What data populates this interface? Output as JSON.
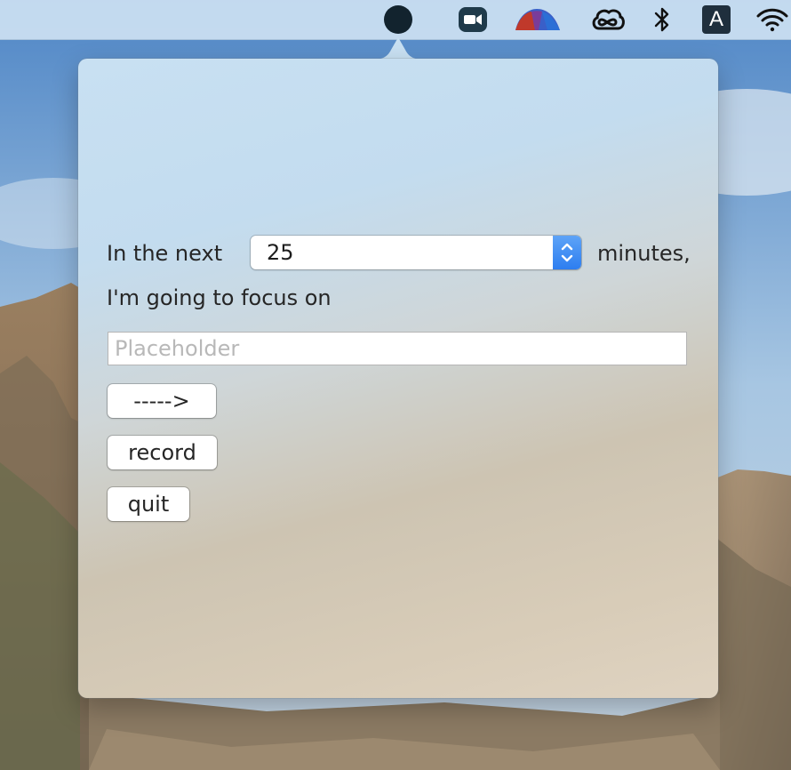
{
  "menubar": {
    "items": [
      {
        "name": "focus-app-icon",
        "color": "#12232e"
      },
      {
        "name": "zoom-icon",
        "color": "#1f3a4a"
      },
      {
        "name": "tunnelblick-icon",
        "color": "#c0392b"
      },
      {
        "name": "creative-cloud-icon",
        "color": "#111111"
      },
      {
        "name": "bluetooth-icon",
        "color": "#111111"
      },
      {
        "name": "input-source-icon",
        "label": "A",
        "color": "#1f2f3d"
      },
      {
        "name": "wifi-icon",
        "color": "#111111"
      }
    ]
  },
  "popover": {
    "in_the_next_label": "In the next",
    "minutes_stepper": {
      "value": "25"
    },
    "minutes_label": "minutes,",
    "focus_prompt": "I'm going to focus on",
    "focus_input": {
      "value": "",
      "placeholder": "Placeholder"
    },
    "buttons": {
      "next": "----->",
      "record": "record",
      "quit": "quit"
    }
  },
  "colors": {
    "accent": "#2d7ef0",
    "text": "#262626",
    "placeholder": "#b8b8b8"
  }
}
